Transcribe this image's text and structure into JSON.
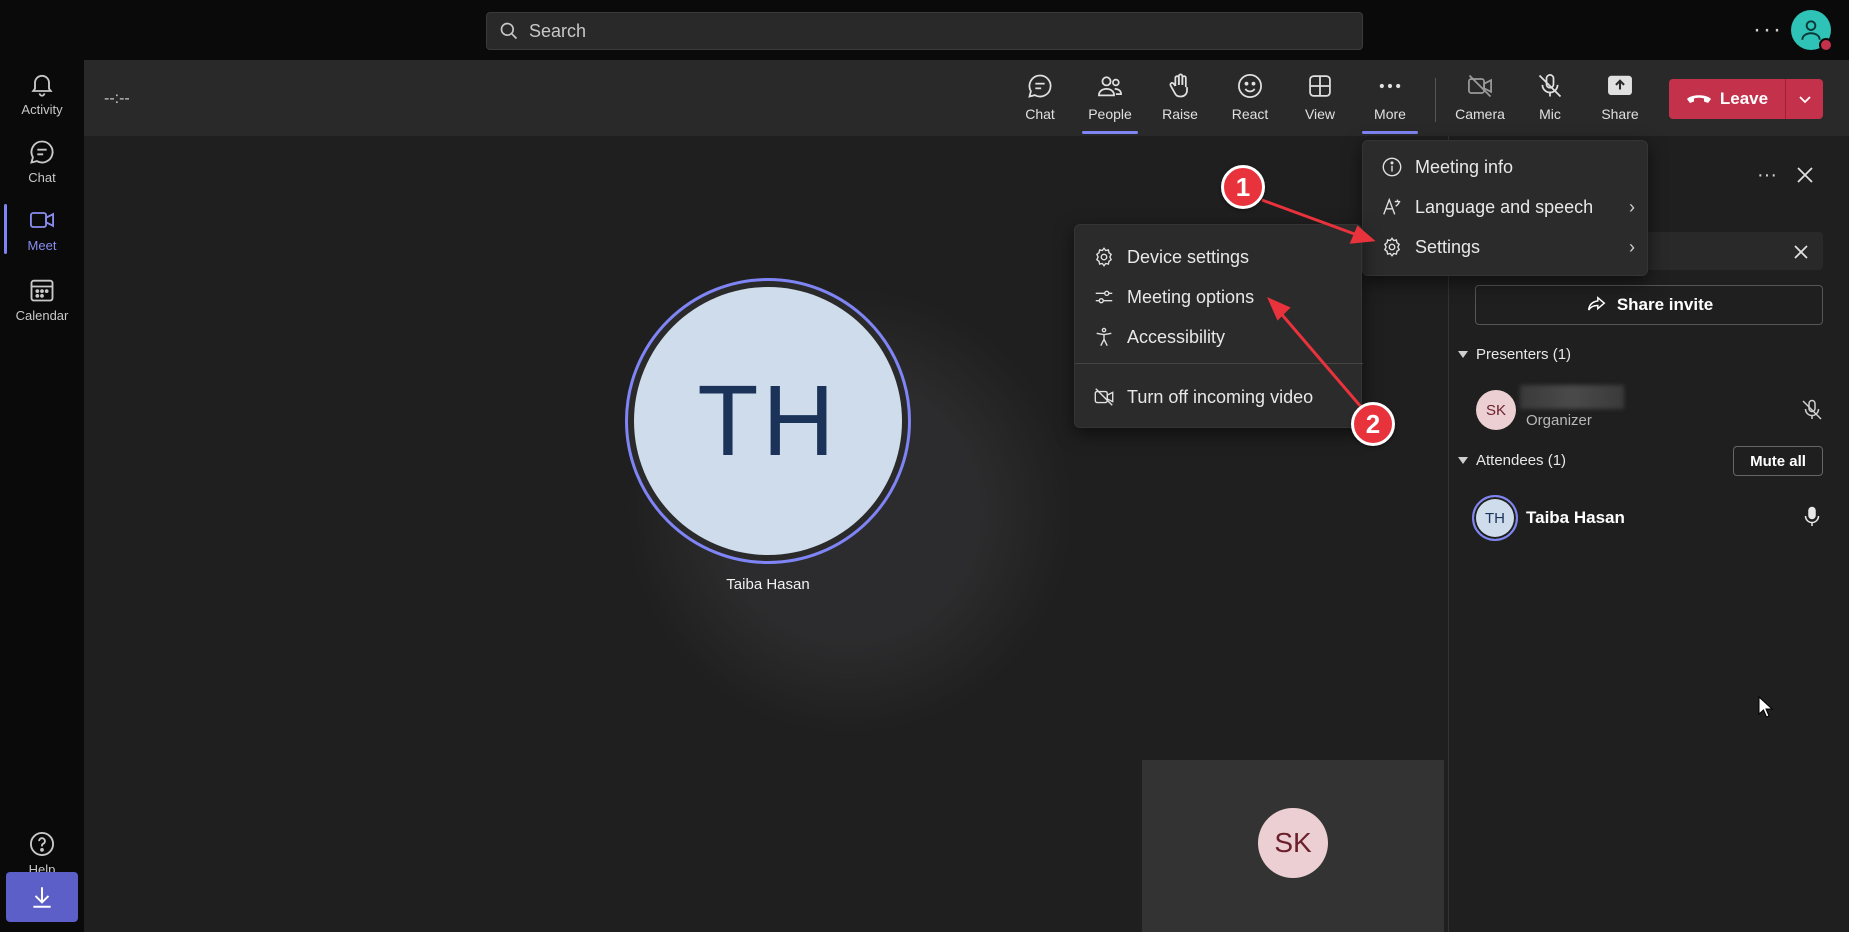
{
  "search": {
    "placeholder": "Search"
  },
  "rail": {
    "items": [
      {
        "label": "Activity"
      },
      {
        "label": "Chat"
      },
      {
        "label": "Meet"
      },
      {
        "label": "Calendar"
      }
    ],
    "help_label": "Help"
  },
  "meeting": {
    "timer": "--:--"
  },
  "toolbar": {
    "chat": "Chat",
    "people": "People",
    "raise": "Raise",
    "react": "React",
    "view": "View",
    "more": "More",
    "camera": "Camera",
    "mic": "Mic",
    "share": "Share",
    "leave": "Leave"
  },
  "stage": {
    "main_initials": "TH",
    "main_name": "Taiba Hasan",
    "self_initials": "SK"
  },
  "more_menu": {
    "items": [
      {
        "label": "Meeting info"
      },
      {
        "label": "Language and speech"
      },
      {
        "label": "Settings"
      }
    ]
  },
  "settings_menu": {
    "items": [
      {
        "label": "Device settings"
      },
      {
        "label": "Meeting options"
      },
      {
        "label": "Accessibility"
      },
      {
        "label": "Turn off incoming video"
      }
    ]
  },
  "panel": {
    "share_invite": "Share invite",
    "presenters_label": "Presenters (1)",
    "presenter": {
      "initials": "SK",
      "role": "Organizer"
    },
    "attendees_label": "Attendees (1)",
    "mute_all": "Mute all",
    "attendee": {
      "initials": "TH",
      "name": "Taiba Hasan"
    }
  },
  "annotations": [
    {
      "label": "1"
    },
    {
      "label": "2"
    }
  ],
  "colors": {
    "accent": "#7f85f5",
    "leave": "#c4314b",
    "annotation": "#e8323c"
  }
}
